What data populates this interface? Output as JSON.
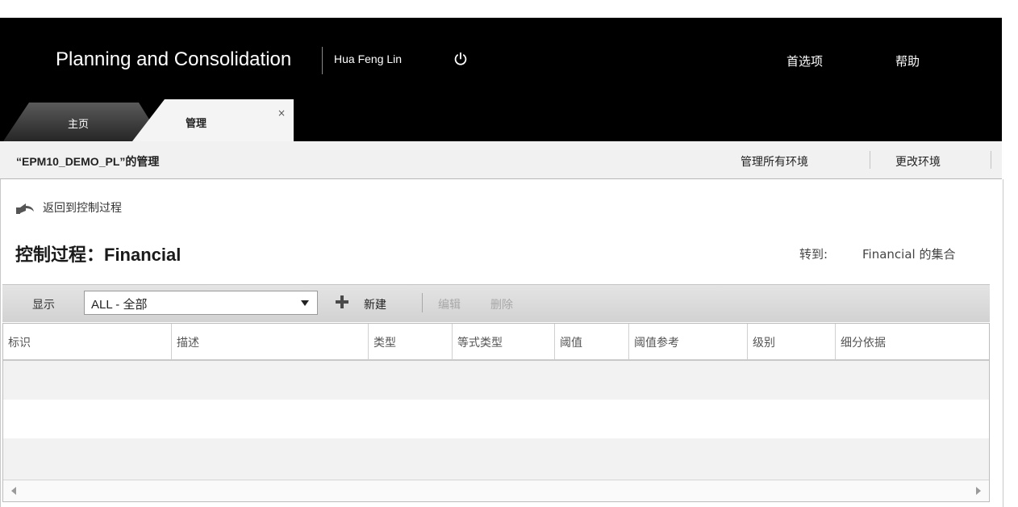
{
  "header": {
    "app_title": "Planning and Consolidation",
    "user_name": "Hua Feng Lin",
    "preferences": "首选项",
    "help": "帮助"
  },
  "tabs": [
    {
      "label": "主页",
      "active": false
    },
    {
      "label": "管理",
      "active": true,
      "close_symbol": "×"
    }
  ],
  "subheader": {
    "environment_title": "“EPM10_DEMO_PL”的管理",
    "manage_all_environments": "管理所有环境",
    "change_environment": "更改环境"
  },
  "content": {
    "back_link": "返回到控制过程",
    "page_title": "控制过程：Financial",
    "goto_label": "转到:",
    "goto_link": "Financial 的集合"
  },
  "toolbar": {
    "show_label": "显示",
    "filter_value": "ALL - 全部",
    "new_label": "新建",
    "edit_label": "编辑",
    "delete_label": "删除"
  },
  "table": {
    "columns": [
      "标识",
      "描述",
      "类型",
      "等式类型",
      "阈值",
      "阈值参考",
      "级别",
      "细分依据"
    ]
  },
  "icons": {
    "power": "power-icon",
    "back": "back-arrow-icon",
    "add": "plus-icon",
    "dropdown": "chevron-down-icon"
  },
  "colors": {
    "header_bg": "#000000",
    "add_icon": "#4a4a4a",
    "disabled_text": "#a8a8a8"
  }
}
